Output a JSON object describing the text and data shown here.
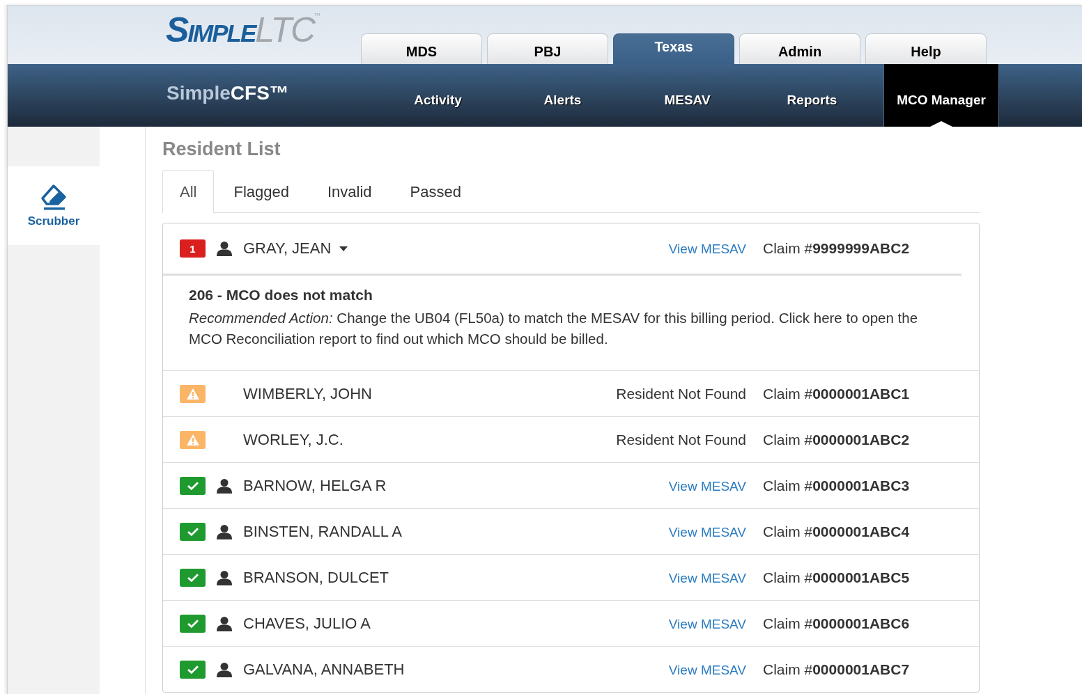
{
  "logo": {
    "first": "Simple",
    "second": "LTC",
    "mark": "™"
  },
  "top_tabs": [
    {
      "label": "MDS",
      "selected": false
    },
    {
      "label": "PBJ",
      "selected": false
    },
    {
      "label": "Texas",
      "selected": true
    },
    {
      "label": "Admin",
      "selected": false
    },
    {
      "label": "Help",
      "selected": false
    }
  ],
  "product": {
    "first": "Simple",
    "second": "CFS™"
  },
  "nav": [
    {
      "label": "Activity",
      "selected": false
    },
    {
      "label": "Alerts",
      "selected": false
    },
    {
      "label": "MESAV",
      "selected": false
    },
    {
      "label": "Reports",
      "selected": false
    },
    {
      "label": "MCO Manager",
      "selected": true
    }
  ],
  "sidebar": {
    "items": [
      {
        "label": "Scrubber",
        "selected": true
      }
    ]
  },
  "page_title": "Resident List",
  "filter_tabs": [
    {
      "label": "All",
      "selected": true
    },
    {
      "label": "Flagged",
      "selected": false
    },
    {
      "label": "Invalid",
      "selected": false
    },
    {
      "label": "Passed",
      "selected": false
    }
  ],
  "residents": [
    {
      "kind": "error",
      "badge": "1",
      "profile_icon": true,
      "name": "GRAY, JEAN",
      "expanded": true,
      "link": "View MESAV",
      "claim": "Claim #**9999999ABC2**",
      "detail": {
        "title": "206 - MCO does not match",
        "text": "*Recommended Action:* Change the UB04 (FL50a) to match the MESAV for this billing period. Click here to open the MCO Reconciliation report to find out which MCO should be billed."
      }
    },
    {
      "kind": "warning",
      "profile_icon": false,
      "name": "WIMBERLY, JOHN",
      "status": "Resident Not Found",
      "claim": "Claim #**0000001ABC1**"
    },
    {
      "kind": "warning",
      "profile_icon": false,
      "name": "WORLEY, J.C.",
      "status": "Resident Not Found",
      "claim": "Claim #**0000001ABC2**"
    },
    {
      "kind": "ok",
      "profile_icon": true,
      "name": "BARNOW, HELGA R",
      "link": "View MESAV",
      "claim": "Claim #**0000001ABC3**"
    },
    {
      "kind": "ok",
      "profile_icon": true,
      "name": "BINSTEN, RANDALL A",
      "link": "View MESAV",
      "claim": "Claim #**0000001ABC4**"
    },
    {
      "kind": "ok",
      "profile_icon": true,
      "name": "BRANSON, DULCET",
      "link": "View MESAV",
      "claim": "Claim #**0000001ABC5**"
    },
    {
      "kind": "ok",
      "profile_icon": true,
      "name": "CHAVES, JULIO A",
      "link": "View MESAV",
      "claim": "Claim #**0000001ABC6**"
    },
    {
      "kind": "ok",
      "profile_icon": true,
      "name": "GALVANA, ANNABETH",
      "link": "View MESAV",
      "claim": "Claim #**0000001ABC7**"
    }
  ]
}
